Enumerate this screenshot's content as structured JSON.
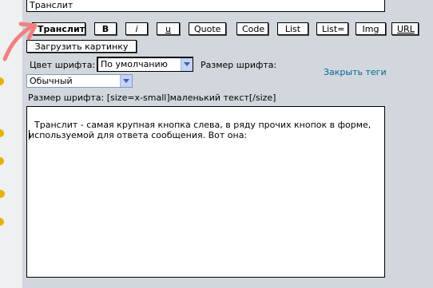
{
  "subject": {
    "value": "Транслит"
  },
  "toolbar": {
    "translit": "Транслит",
    "bold": "B",
    "italic": "i",
    "underline": "u",
    "quote": "Quote",
    "code": "Code",
    "list": "List",
    "list_ordered": "List=",
    "img": "Img",
    "url": "URL",
    "upload_images": "Загрузить картинку"
  },
  "font": {
    "color_label": "Цвет шрифта:",
    "color_value": "По умолчанию",
    "size_label": "Размер шрифта:",
    "size_value": "Обычный"
  },
  "close_tags": "Закрыть теги",
  "help_line": "Размер шрифта: [size=x-small]маленький текст[/size]",
  "message": {
    "text": "Транслит - самая крупная кнопка слева, в ряду прочих кнопок в форме, используемой для ответа сообщения. Вот она:"
  },
  "colors": {
    "background": "#d1d7dc",
    "link": "#006699",
    "arrow_annotation": "#f08080"
  }
}
